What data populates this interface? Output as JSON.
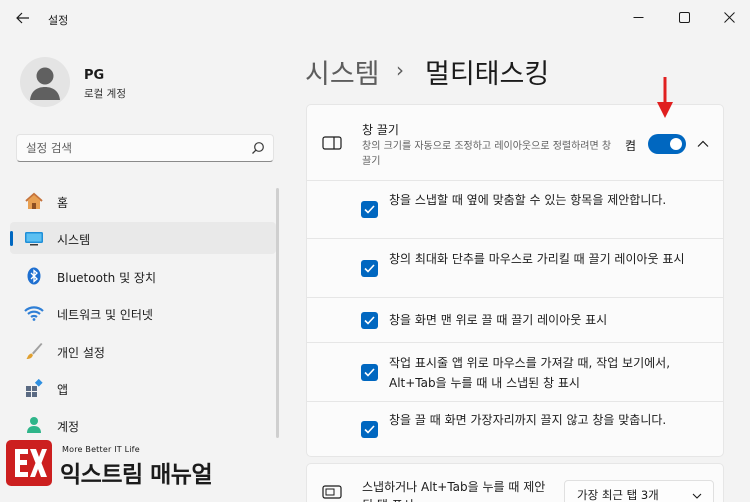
{
  "window": {
    "title": "설정"
  },
  "profile": {
    "name": "PG",
    "account_type": "로컬 계정"
  },
  "search": {
    "placeholder": "설정 검색"
  },
  "nav": {
    "items": [
      {
        "label": "홈",
        "icon": "home-icon"
      },
      {
        "label": "시스템",
        "icon": "system-icon",
        "active": true
      },
      {
        "label": "Bluetooth 및 장치",
        "icon": "bluetooth-icon"
      },
      {
        "label": "네트워크 및 인터넷",
        "icon": "wifi-icon"
      },
      {
        "label": "개인 설정",
        "icon": "brush-icon"
      },
      {
        "label": "앱",
        "icon": "apps-icon"
      },
      {
        "label": "계정",
        "icon": "account-icon"
      }
    ]
  },
  "breadcrumb": {
    "parent": "시스템",
    "separator": "›",
    "current": "멀티태스킹"
  },
  "snap": {
    "title": "창 끌기",
    "description": "창의 크기를 자동으로 조정하고 레이아웃으로 정렬하려면 창 끌기",
    "toggle_label": "켬",
    "toggle_on": true,
    "options": [
      {
        "text": "창을 스냅할 때 옆에 맞춤할 수 있는 항목을 제안합니다.",
        "checked": true
      },
      {
        "text": "창의 최대화 단추를 마우스로 가리킬 때 끌기 레이아웃 표시",
        "checked": true
      },
      {
        "text": "창을 화면 맨 위로 끌 때 끌기 레이아웃 표시",
        "checked": true
      },
      {
        "text": "작업 표시줄 앱 위로 마우스를 가져갈 때, 작업 보기에서, Alt+Tab을 누를 때 내 스냅된 창 표시",
        "checked": true
      },
      {
        "text": "창을 끌 때 화면 가장자리까지 끌지 않고 창을 맞춥니다.",
        "checked": true
      }
    ]
  },
  "alt_tab": {
    "text": "스냅하거나 Alt+Tab을 누를 때 제안된 탭 표시",
    "selected": "가장 최근 탭 3개"
  },
  "watermark": {
    "tagline": "More Better IT Life",
    "name": "익스트림 매뉴얼"
  },
  "colors": {
    "accent": "#0067c0",
    "annotation": "#e02020",
    "watermark": "#cc1f1f"
  }
}
